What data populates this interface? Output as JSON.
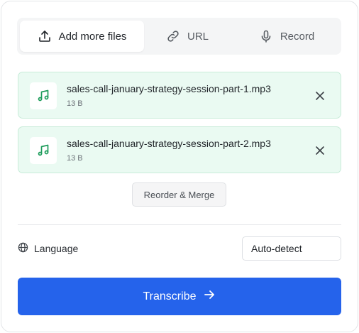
{
  "tabs": [
    {
      "label": "Add more files",
      "icon": "upload-icon",
      "active": true
    },
    {
      "label": "URL",
      "icon": "link-icon",
      "active": false
    },
    {
      "label": "Record",
      "icon": "microphone-icon",
      "active": false
    }
  ],
  "files": [
    {
      "name": "sales-call-january-strategy-session-part-1.mp3",
      "size": "13 B",
      "icon": "music-note-icon"
    },
    {
      "name": "sales-call-january-strategy-session-part-2.mp3",
      "size": "13 B",
      "icon": "music-note-icon"
    }
  ],
  "merge_label": "Reorder & Merge",
  "language": {
    "label": "Language",
    "value": "Auto-detect",
    "icon": "globe-icon"
  },
  "submit": {
    "label": "Transcribe",
    "icon": "arrow-right-icon"
  },
  "colors": {
    "accent": "#2563eb",
    "file_bg": "#eafaf2",
    "file_border": "#c8ecd9",
    "music_icon": "#1f9d5c"
  }
}
